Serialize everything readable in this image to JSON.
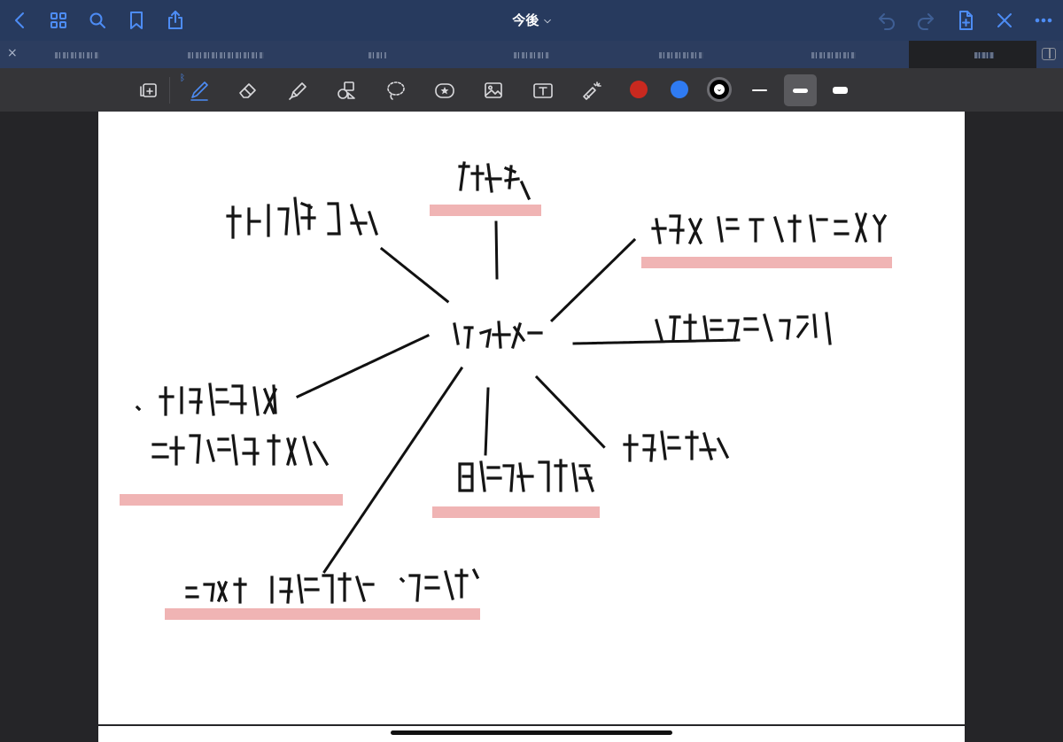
{
  "window": {
    "title": "今後"
  },
  "topbar": {
    "left_icons": [
      "back-chevron-icon",
      "grid-icon",
      "search-icon",
      "bookmark-icon",
      "share-icon"
    ],
    "right_icons": [
      "undo-icon",
      "redo-icon",
      "add-page-icon",
      "close-pencil-icon",
      "more-icon"
    ]
  },
  "tabs": {
    "close_glyph": "×"
  },
  "toolbar": {
    "tools": [
      "read-only-mode-icon",
      "pen-icon",
      "eraser-icon",
      "highlighter-icon",
      "shapes-icon",
      "lasso-icon",
      "sticker-icon",
      "image-icon",
      "text-icon",
      "laser-pointer-icon"
    ],
    "active_tool": "pen-icon",
    "colors": [
      "#c9291f",
      "#2f7bf2",
      "#000000"
    ],
    "selected_color": "#000000",
    "selected_thickness": 2
  },
  "theme": {
    "accent": "#4d8cf5",
    "highlight": "#f0b4b4"
  }
}
